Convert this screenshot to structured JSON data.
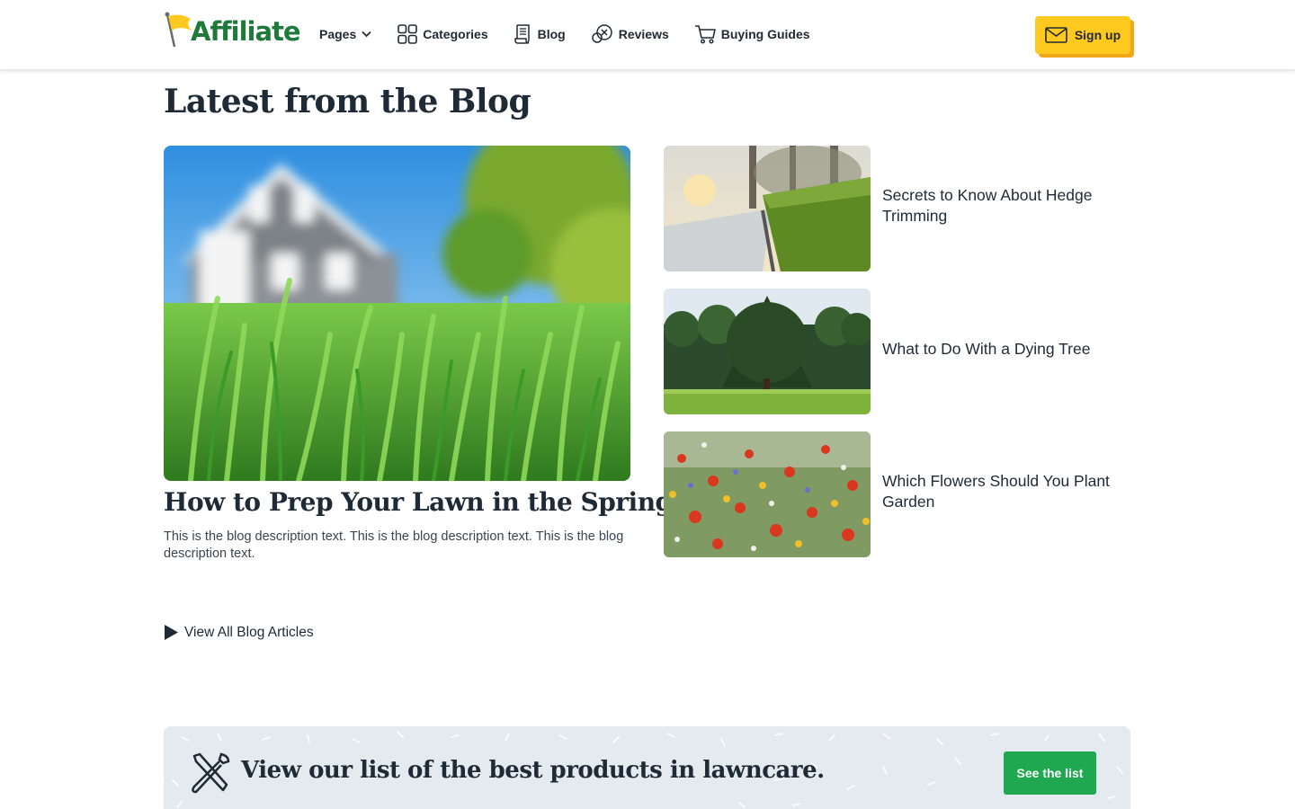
{
  "header": {
    "logo_text": "Affiliate",
    "nav": [
      {
        "label": "Pages",
        "icon": "chevron-down-icon"
      },
      {
        "label": "Categories",
        "icon": "grid-icon"
      },
      {
        "label": "Blog",
        "icon": "document-icon"
      },
      {
        "label": "Reviews",
        "icon": "review-icon"
      },
      {
        "label": "Buying Guides",
        "icon": "cart-icon"
      }
    ],
    "signup_label": "Sign up"
  },
  "blog": {
    "title": "Latest from the Blog",
    "featured": {
      "title": "How to Prep Your Lawn in the Spring",
      "description": "This is the blog description text. This is the blog description text. This is the blog description text."
    },
    "posts": [
      {
        "title": "Secrets to Know About Hedge Trimming"
      },
      {
        "title": "What to Do With a Dying Tree"
      },
      {
        "title": "Which Flowers Should You Plant Garden"
      }
    ],
    "view_all_label": "View All Blog Articles"
  },
  "banner": {
    "text": "View our list of the best products in lawncare.",
    "button_label": "See the list"
  },
  "colors": {
    "accent_yellow": "#ffc91f",
    "accent_green": "#1fa84f",
    "logo_green": "#1f7a3a",
    "text_dark": "#1e2a35",
    "banner_bg": "#e5eaef"
  }
}
